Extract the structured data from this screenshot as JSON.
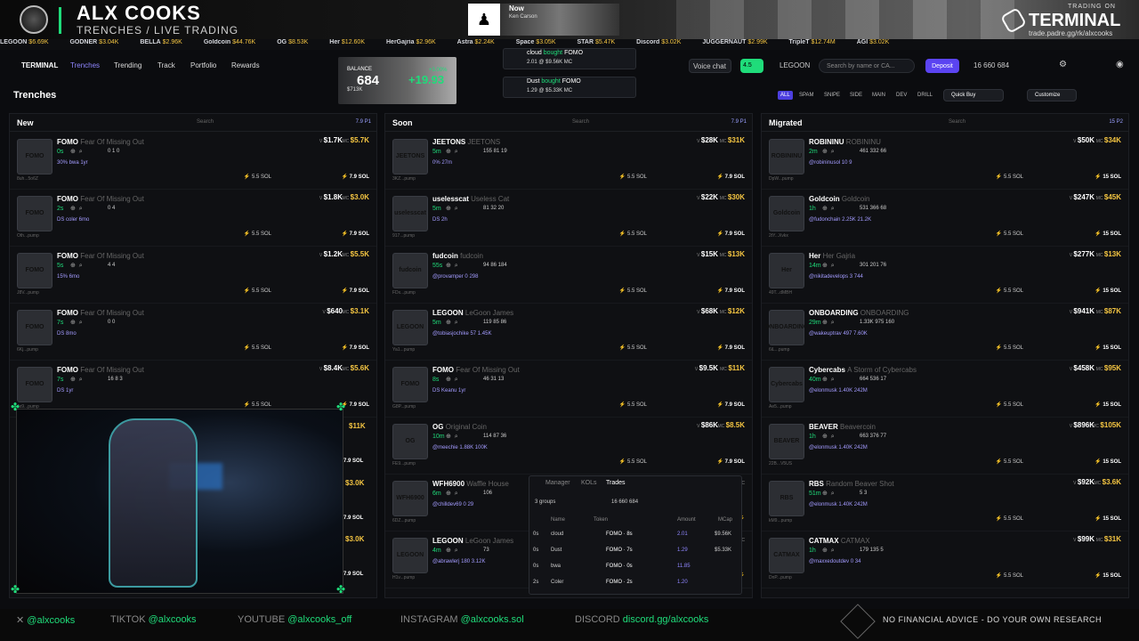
{
  "banner": {
    "brand": "ALX COOKS",
    "subtitle": "TRENCHES / LIVE TRADING",
    "trading_on": "TRADING ON",
    "terminal": "TERMINAL",
    "url": "trade.padre.gg/rk/alxcooks",
    "now": {
      "label": "Now",
      "artist": "Ken Carson"
    }
  },
  "ticker": [
    {
      "name": "LEGOON",
      "value": "$6.69K"
    },
    {
      "name": "GODNER",
      "value": "$3.04K"
    },
    {
      "name": "BELLA",
      "value": "$2.96K"
    },
    {
      "name": "Goldcoin",
      "value": "$44.76K"
    },
    {
      "name": "OG",
      "value": "$8.53K"
    },
    {
      "name": "Her",
      "value": "$12.60K"
    },
    {
      "name": "HerGajria",
      "value": "$2.96K"
    },
    {
      "name": "Astra",
      "value": "$2.24K"
    },
    {
      "name": "Space",
      "value": "$3.05K"
    },
    {
      "name": "STAR",
      "value": "$5.47K"
    },
    {
      "name": "Discord",
      "value": "$3.02K"
    },
    {
      "name": "JUGGERNAUT",
      "value": "$2.99K"
    },
    {
      "name": "TripleT",
      "value": "$12.74M"
    },
    {
      "name": "AGI",
      "value": "$3.02K"
    }
  ],
  "nav": {
    "logo": "TERMINAL",
    "items": [
      "Trenches",
      "Trending",
      "Track",
      "Portfolio",
      "Rewards"
    ],
    "voice_chat": "Voice chat",
    "badge": "4.5",
    "legoon": "LEGOON",
    "search_placeholder": "Search by name or CA...",
    "search_key": "/",
    "deposit": "Deposit",
    "counts": "16  660  684"
  },
  "balance": {
    "label": "BALANCE",
    "value": "684",
    "pct": "+3.00%",
    "usd": "+19.93",
    "sub": "$713K"
  },
  "notifications": [
    {
      "user": "cloud",
      "action": "bought",
      "token": "FOMO",
      "amount": "2.01",
      "mc": "@ $9.56K MC"
    },
    {
      "user": "Dust",
      "action": "bought",
      "token": "FOMO",
      "amount": "1.29",
      "mc": "@ $5.33K MC"
    }
  ],
  "toolbar": {
    "title": "Trenches",
    "filters": [
      "ALL",
      "SPAM",
      "SNIPE",
      "SIDE",
      "MAIN",
      "DEV",
      "DRILL"
    ],
    "quick_buy": "Quick Buy",
    "customize": "Customize"
  },
  "columns": [
    {
      "title": "New",
      "search": "Search",
      "controls": "7.9  P1",
      "rows": [
        {
          "ticker": "FOMO",
          "name": "Fear Of Missing Out",
          "age": "0s",
          "stats": "0  1  0",
          "tag": "30%  bwa 1yr",
          "vol": "$1.7K",
          "mc": "$5.7K",
          "buy": "5.5 SOL",
          "sol": "7.9 SOL",
          "sub": "8uh...5o6Z"
        },
        {
          "ticker": "FOMO",
          "name": "Fear Of Missing Out",
          "age": "2s",
          "stats": "0  4",
          "tag": "DS  coler  6mo",
          "vol": "$1.8K",
          "mc": "$3.0K",
          "buy": "5.5 SOL",
          "sol": "7.9 SOL",
          "sub": "Oth...pump"
        },
        {
          "ticker": "FOMO",
          "name": "Fear Of Missing Out",
          "age": "5s",
          "stats": "4  4",
          "tag": "15%  6mo",
          "vol": "$1.2K",
          "mc": "$5.5K",
          "buy": "5.5 SOL",
          "sol": "7.9 SOL",
          "sub": "J8V...pump"
        },
        {
          "ticker": "FOMO",
          "name": "Fear Of Missing Out",
          "age": "7s",
          "stats": "0  0",
          "tag": "DS  8mo",
          "vol": "$640",
          "mc": "$3.1K",
          "buy": "5.5 SOL",
          "sol": "7.9 SOL",
          "sub": "6Kj...pump"
        },
        {
          "ticker": "FOMO",
          "name": "Fear Of Missing Out",
          "age": "7s",
          "stats": "16  8  3",
          "tag": "DS  1yr",
          "vol": "$8.4K",
          "mc": "$5.6K",
          "buy": "5.5 SOL",
          "sol": "7.9 SOL",
          "sub": "4x9...pump"
        }
      ]
    },
    {
      "title": "Soon",
      "search": "Search",
      "controls": "7.9  P1",
      "rows": [
        {
          "ticker": "JEETONS",
          "name": "JEETONS",
          "age": "5m",
          "stats": "155  81  19",
          "tag": "0%  27m",
          "vol": "$28K",
          "mc": "$31K",
          "buy": "5.5 SOL",
          "sol": "7.9 SOL",
          "sub": "3KZ...pump"
        },
        {
          "ticker": "uselesscat",
          "name": "Useless Cat",
          "age": "5m",
          "stats": "81  32  20",
          "tag": "DS  2h",
          "vol": "$22K",
          "mc": "$30K",
          "buy": "5.5 SOL",
          "sol": "7.9 SOL",
          "sub": "917...pump"
        },
        {
          "ticker": "fudcoin",
          "name": "fudcoin",
          "age": "55s",
          "stats": "94  86  184",
          "tag": "@provamper  0  298",
          "vol": "$15K",
          "mc": "$13K",
          "buy": "5.5 SOL",
          "sol": "7.9 SOL",
          "sub": "FDx...pump"
        },
        {
          "ticker": "LEGOON",
          "name": "LeGoon James",
          "age": "5m",
          "stats": "119  85  86",
          "tag": "@tobiasjochike  57  1.45K",
          "vol": "$68K",
          "mc": "$12K",
          "buy": "5.5 SOL",
          "sol": "7.9 SOL",
          "sub": "Ya1...pump"
        },
        {
          "ticker": "FOMO",
          "name": "Fear Of Missing Out",
          "age": "8s",
          "stats": "46  31  13",
          "tag": "DS  Keanu  1yr",
          "vol": "$9.5K",
          "mc": "$11K",
          "buy": "5.5 SOL",
          "sol": "7.9 SOL",
          "sub": "G8P...pump"
        },
        {
          "ticker": "OG",
          "name": "Original Coin",
          "age": "10m",
          "stats": "114  87  36",
          "tag": "@meechie  1.88K  100K",
          "vol": "$86K",
          "mc": "$8.5K",
          "buy": "5.5 SOL",
          "sol": "7.9 SOL",
          "sub": "FE9...pump"
        },
        {
          "ticker": "WFH6900",
          "name": "Waffle House",
          "age": "6m",
          "stats": "106",
          "tag": "@chilldev69  0  29",
          "vol": "",
          "mc": "",
          "buy": "",
          "sol": "",
          "sub": "6DZ...pump"
        },
        {
          "ticker": "LEGOON",
          "name": "LeGoon James",
          "age": "4m",
          "stats": "73",
          "tag": "@abrawlerj  180  3.12K",
          "vol": "",
          "mc": "",
          "buy": "",
          "sol": "",
          "sub": "H1v...pump"
        }
      ]
    },
    {
      "title": "Migrated",
      "search": "Search",
      "controls": "15  P2",
      "rows": [
        {
          "ticker": "ROBININU",
          "name": "ROBININU",
          "age": "2m",
          "stats": "461  332  66",
          "tag": "@robininusol  10  9",
          "vol": "$50K",
          "mc": "$34K",
          "buy": "5.5 SOL",
          "sol": "15 SOL",
          "sub": "DpW...pump"
        },
        {
          "ticker": "Goldcoin",
          "name": "Goldcoin",
          "age": "1h",
          "stats": "531  366  68",
          "tag": "@fudonchain  2.25K  21.2K",
          "vol": "$247K",
          "mc": "$45K",
          "buy": "5.5 SOL",
          "sol": "15 SOL",
          "sub": "2tY...Xvkx"
        },
        {
          "ticker": "Her",
          "name": "Her Gajria",
          "age": "14m",
          "stats": "301  201  76",
          "tag": "@nikitadevelops  3  744",
          "vol": "$277K",
          "mc": "$13K",
          "buy": "5.5 SOL",
          "sol": "15 SOL",
          "sub": "49T...dMBH"
        },
        {
          "ticker": "ONBOARDING",
          "name": "ONBOARDING",
          "age": "29m",
          "stats": "1.33K  975  160",
          "tag": "@wakeuptrav  497  7.60K",
          "vol": "$941K",
          "mc": "$87K",
          "buy": "5.5 SOL",
          "sol": "15 SOL",
          "sub": "6iL...pump"
        },
        {
          "ticker": "Cybercabs",
          "name": "A Storm of Cybercabs",
          "age": "40m",
          "stats": "664  536  17",
          "tag": "@elonmusk  1.40K  242M",
          "vol": "$458K",
          "mc": "$95K",
          "buy": "5.5 SOL",
          "sol": "15 SOL",
          "sub": "Ae5...pump"
        },
        {
          "ticker": "BEAVER",
          "name": "Beavercoin",
          "age": "1h",
          "stats": "663  376  77",
          "tag": "@elonmusk  1.40K  242M",
          "vol": "$896K",
          "mc": "$105K",
          "buy": "5.5 SOL",
          "sol": "15 SOL",
          "sub": "22B...V5US"
        },
        {
          "ticker": "RBS",
          "name": "Random Beaver Shot",
          "age": "51m",
          "stats": "5  3",
          "tag": "@elonmusk  1.40K  242M",
          "vol": "$92K",
          "mc": "$3.6K",
          "buy": "5.5 SOL",
          "sol": "15 SOL",
          "sub": "kM9...pump"
        },
        {
          "ticker": "CATMAX",
          "name": "CATMAX",
          "age": "1h",
          "stats": "179  135  5",
          "tag": "@maxxedoutdev  0  34",
          "vol": "$99K",
          "mc": "$31K",
          "buy": "5.5 SOL",
          "sol": "15 SOL",
          "sub": "DnP...pump"
        }
      ]
    }
  ],
  "trades": {
    "tabs": [
      "Manager",
      "KOLs",
      "Trades"
    ],
    "groups": "3 groups",
    "counts": "16  660  684",
    "headers": [
      "Name",
      "Token",
      "Amount",
      "MCap"
    ],
    "rows": [
      {
        "age": "0s",
        "name": "cloud",
        "token": "FOMO · 8s",
        "amount": "2.01",
        "mcap": "$9.56K"
      },
      {
        "age": "0s",
        "name": "Dust",
        "token": "FOMO · 7s",
        "amount": "1.29",
        "mcap": "$5.33K"
      },
      {
        "age": "0s",
        "name": "bwa",
        "token": "FOMO · 0s",
        "amount": "11.85",
        "mcap": ""
      },
      {
        "age": "2s",
        "name": "Coler",
        "token": "FOMO · 2s",
        "amount": "1.20",
        "mcap": ""
      }
    ]
  },
  "webcam_overlay": {
    "v1": "$11K",
    "v2": "7.9 SOL",
    "v3": "$3.0K",
    "v4": "7.9 SOL",
    "v5": "$3.0K",
    "v6": "7.9 SOL"
  },
  "footer": {
    "x": "@alxcooks",
    "tiktok_label": "TIKTOK",
    "tiktok": "@alxcooks",
    "youtube_label": "YOUTUBE",
    "youtube": "@alxcooks_off",
    "instagram_label": "INSTAGRAM",
    "instagram": "@alxcooks.sol",
    "discord_label": "DISCORD",
    "discord": "discord.gg/alxcooks",
    "disclaimer": "NO FINANCIAL ADVICE - DO YOUR OWN RESEARCH"
  },
  "colors": {
    "accent": "#1fdc7a",
    "brand": "#5b44f2",
    "mc": "#f4c542"
  }
}
